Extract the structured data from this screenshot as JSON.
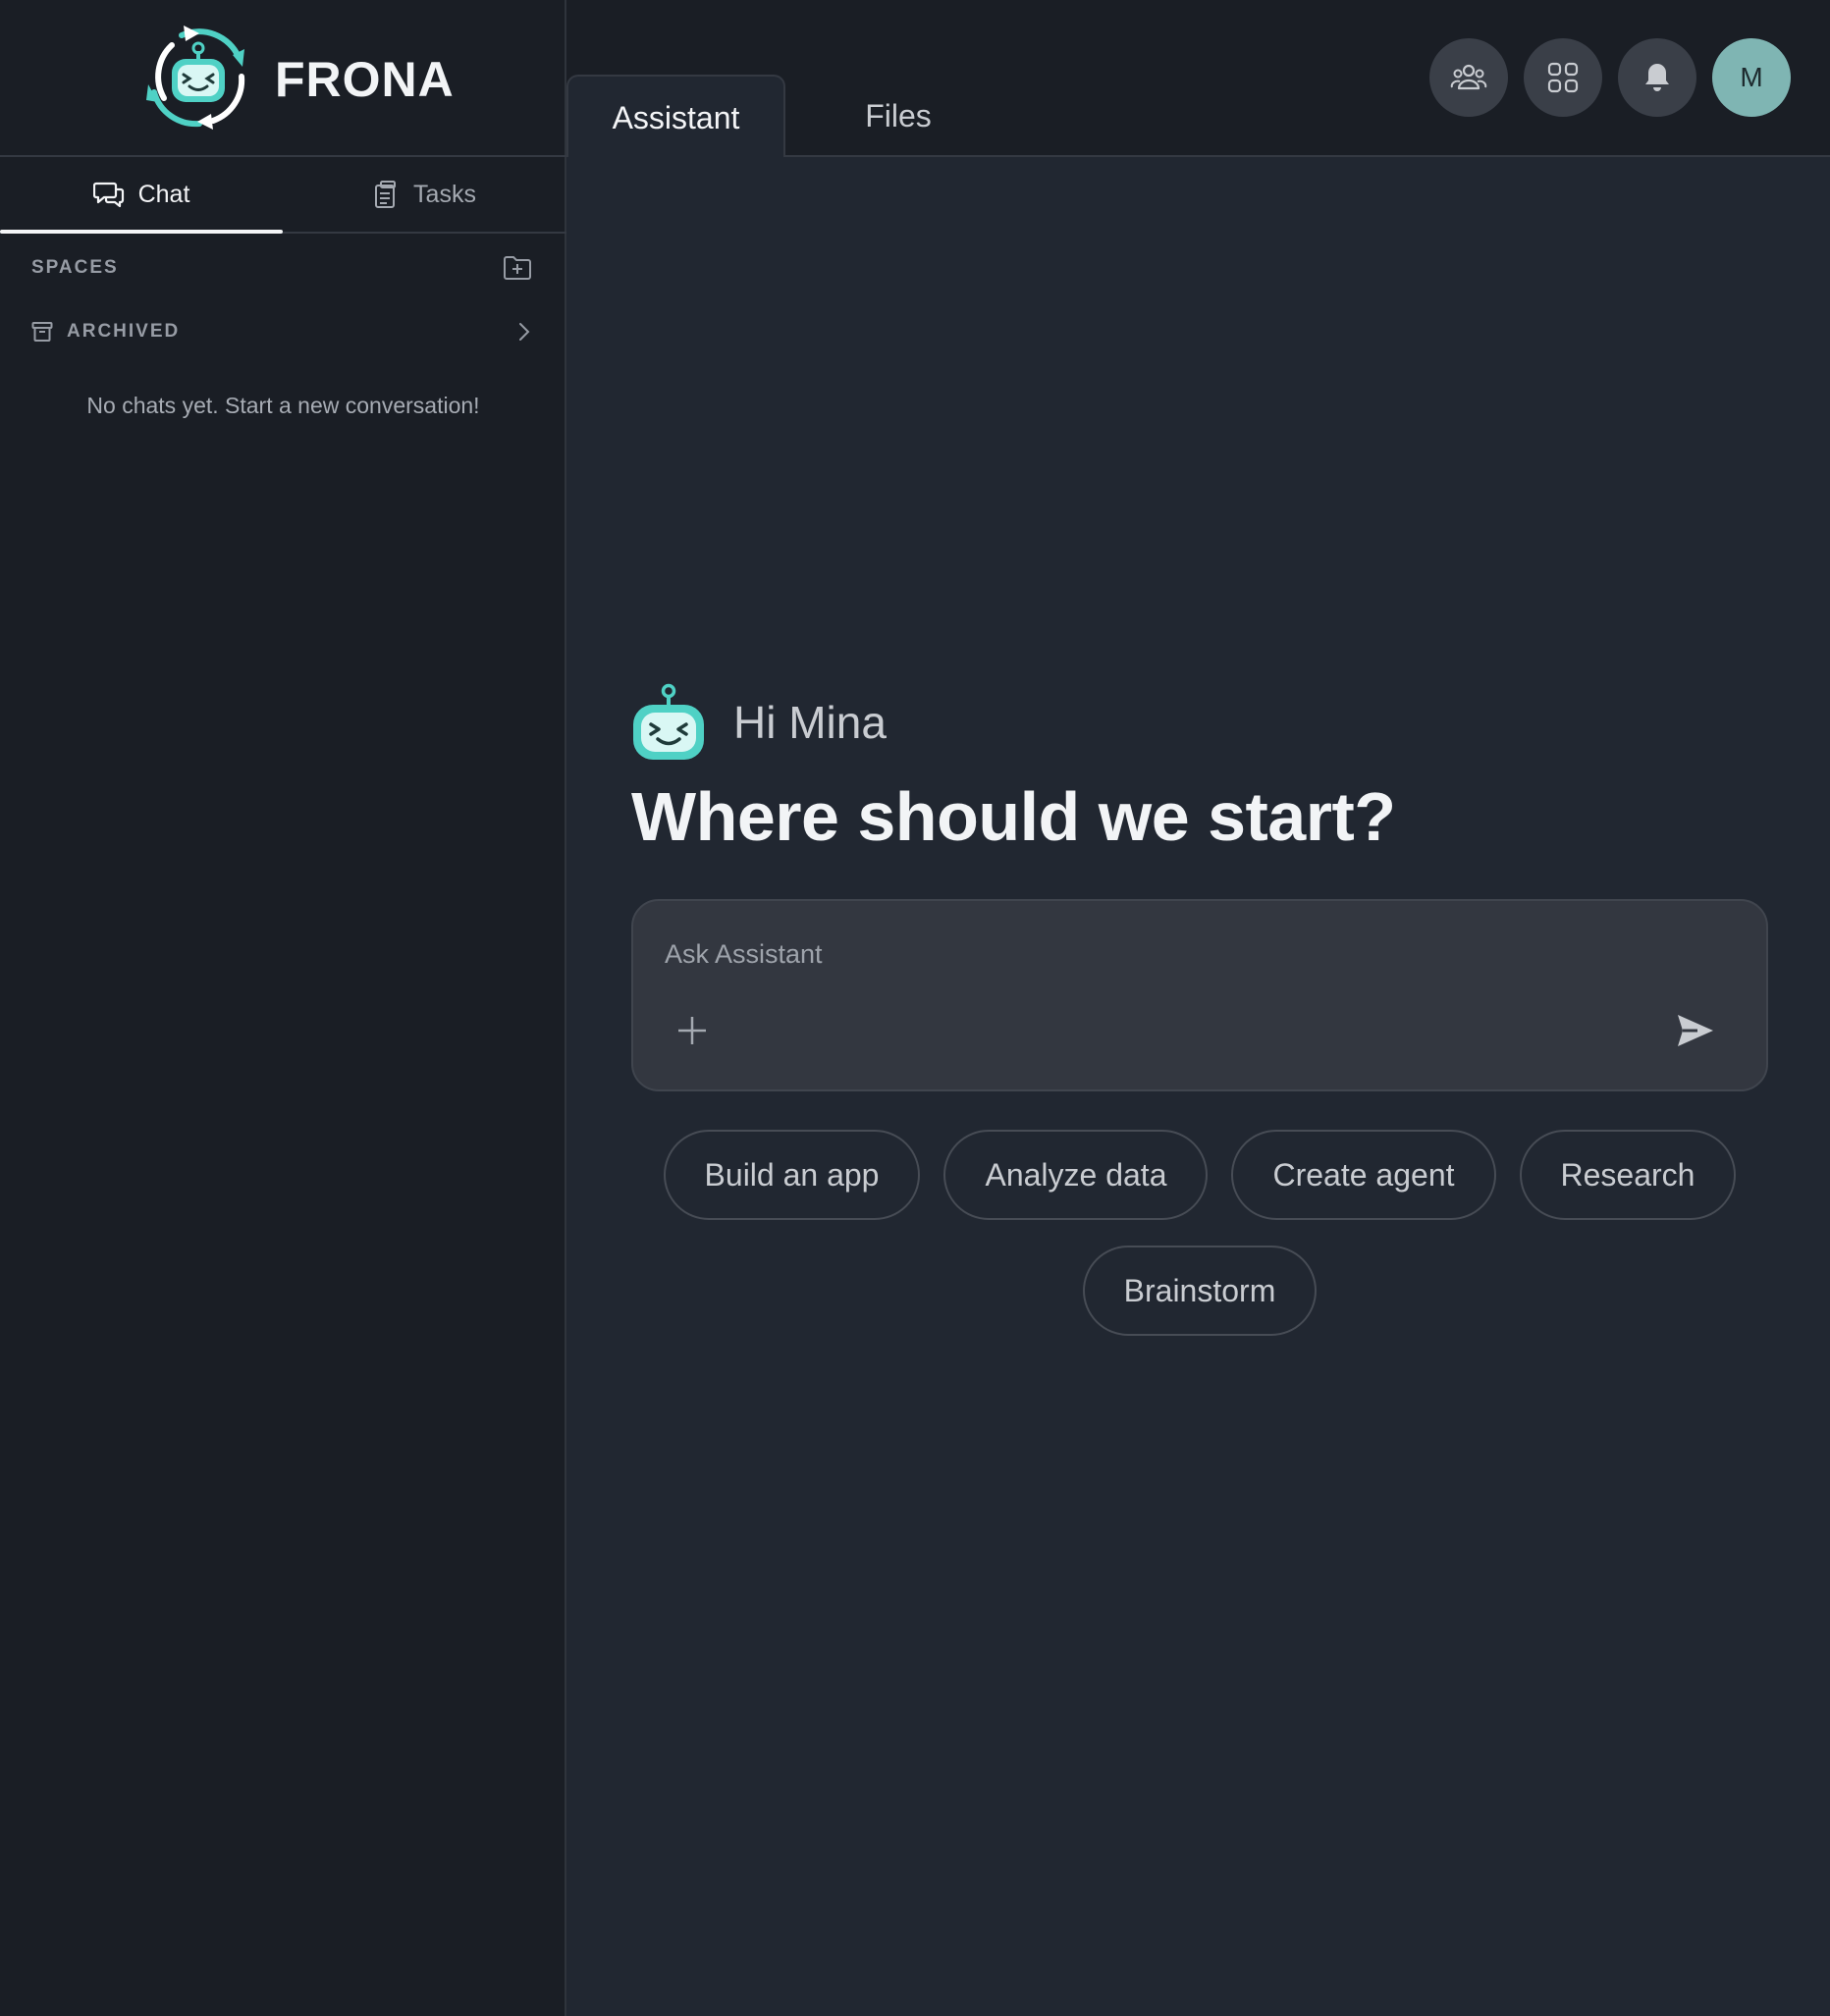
{
  "brand": {
    "name": "FRONA",
    "logo_icon": "robot-sync-logo"
  },
  "sidebar": {
    "tabs": [
      {
        "label": "Chat",
        "icon": "chat-bubbles-icon",
        "active": true
      },
      {
        "label": "Tasks",
        "icon": "clipboard-icon",
        "active": false
      }
    ],
    "spaces_label": "SPACES",
    "archived_label": "ARCHIVED",
    "empty_message": "No chats yet. Start a new conversation!"
  },
  "topbar": {
    "tabs": [
      {
        "label": "Assistant",
        "active": true
      },
      {
        "label": "Files",
        "active": false
      }
    ],
    "avatar_initial": "M",
    "buttons": [
      "people-icon",
      "apps-grid-icon",
      "bell-icon"
    ]
  },
  "main": {
    "greeting": "Hi Mina",
    "headline": "Where should we start?",
    "composer": {
      "placeholder": "Ask Assistant",
      "value": ""
    },
    "suggestions": [
      "Build an app",
      "Analyze data",
      "Create agent",
      "Research",
      "Brainstorm"
    ]
  },
  "colors": {
    "accent_teal": "#4fd1c5",
    "avatar_bg": "#7fb5b3",
    "sidebar_bg": "#1a1e25",
    "main_bg": "#212731"
  }
}
